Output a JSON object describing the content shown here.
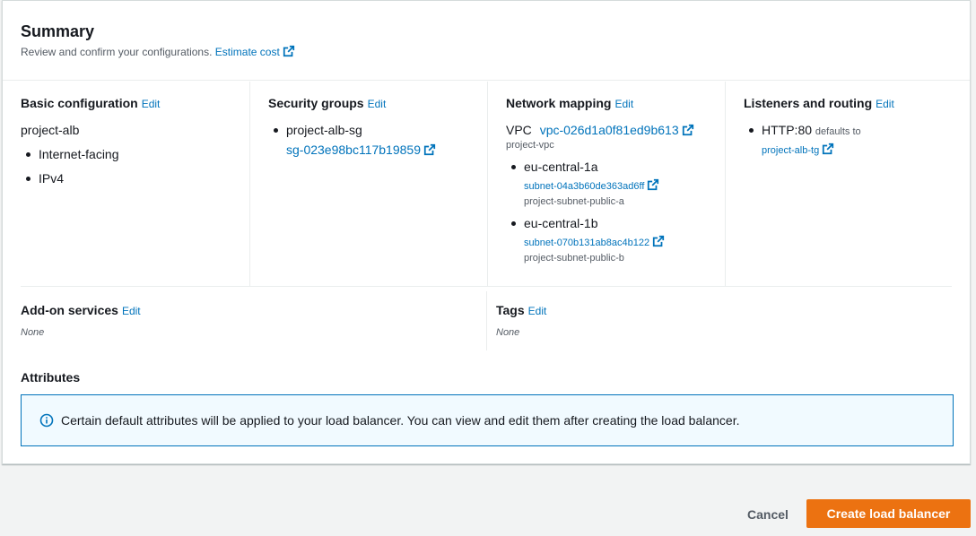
{
  "summary": {
    "title": "Summary",
    "subtitle": "Review and confirm your configurations.",
    "estimate_cost": "Estimate cost"
  },
  "basic_configuration": {
    "heading": "Basic configuration",
    "edit": "Edit",
    "name": "project-alb",
    "items": [
      "Internet-facing",
      "IPv4"
    ]
  },
  "security_groups": {
    "heading": "Security groups",
    "edit": "Edit",
    "group_name": "project-alb-sg",
    "group_id": "sg-023e98bc117b19859"
  },
  "network_mapping": {
    "heading": "Network mapping",
    "edit": "Edit",
    "vpc_label": "VPC",
    "vpc_id": "vpc-026d1a0f81ed9b613",
    "vpc_name": "project-vpc",
    "zones": [
      {
        "zone": "eu-central-1a",
        "subnet_id": "subnet-04a3b60de363ad6ff",
        "subnet_name": "project-subnet-public-a"
      },
      {
        "zone": "eu-central-1b",
        "subnet_id": "subnet-070b131ab8ac4b122",
        "subnet_name": "project-subnet-public-b"
      }
    ]
  },
  "listeners": {
    "heading": "Listeners and routing",
    "edit": "Edit",
    "listener": "HTTP:80",
    "defaults_to": "defaults to",
    "target_group": "project-alb-tg"
  },
  "addon": {
    "heading": "Add-on services",
    "edit": "Edit",
    "value": "None"
  },
  "tags": {
    "heading": "Tags",
    "edit": "Edit",
    "value": "None"
  },
  "attributes": {
    "heading": "Attributes",
    "info": "Certain default attributes will be applied to your load balancer. You can view and edit them after creating the load balancer."
  },
  "footer": {
    "cancel": "Cancel",
    "create": "Create load balancer"
  },
  "colors": {
    "link": "#0073bb",
    "primary_button": "#ec7211",
    "info_border": "#0073bb",
    "info_bg": "#f1faff"
  },
  "icons": {
    "external": "external-link-icon",
    "info": "info-icon"
  }
}
